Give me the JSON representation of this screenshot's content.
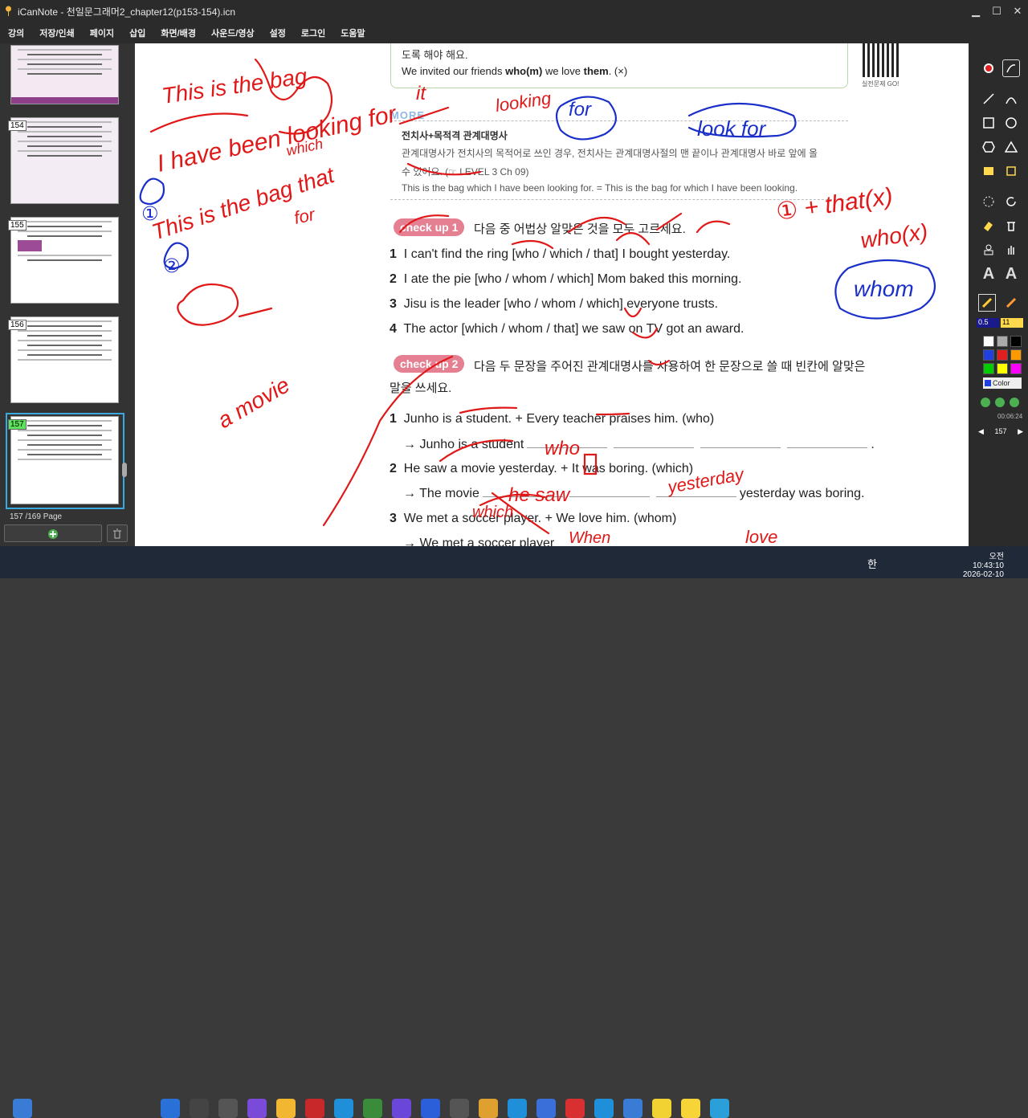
{
  "window": {
    "title": "iCanNote - 천일문그래머2_chapter12(p153-154).icn"
  },
  "menu": [
    "강의",
    "저장/인쇄",
    "페이지",
    "삽입",
    "화면/배경",
    "사운드/영상",
    "설정",
    "로그인",
    "도움말"
  ],
  "thumbnails": [
    {
      "num": "154",
      "active": false
    },
    {
      "num": "155",
      "active": false
    },
    {
      "num": "156",
      "active": false
    },
    {
      "num": "157",
      "active": true
    }
  ],
  "pageinfo": {
    "current": "157",
    "total": "/169 Page"
  },
  "doc": {
    "top_line1": "도록 해야 해요.",
    "top_line2_pre": "We invited our friends ",
    "top_line2_b1": "who(m)",
    "top_line2_mid": " we love ",
    "top_line2_b2": "them",
    "top_line2_post": ". (×)",
    "qr_label": "실전문제 GO!",
    "more_label": "MORE",
    "more_title": "전치사+목적격 관계대명사",
    "more_body1": "관계대명사가 전치사의 목적어로 쓰인 경우, 전치사는 관계대명사절의 맨 끝이나 관계대명사 바로 앞에 올",
    "more_body2": "수 있어요. (☞ LEVEL 3 Ch 09)",
    "more_ex": "This is the bag which I have been looking for. = This is the bag for which I have been looking.",
    "check1_label": "check up 1",
    "check1_instr": "다음 중 어법상 알맞은 것을 모두 고르세요.",
    "check1_items": [
      {
        "n": "1",
        "t": "I can't find the ring [who / which / that] I bought yesterday."
      },
      {
        "n": "2",
        "t": "I ate the pie [who / whom / which] Mom baked this morning."
      },
      {
        "n": "3",
        "t": "Jisu is the leader [who / whom / which] everyone trusts."
      },
      {
        "n": "4",
        "t": "The actor [which / whom / that] we saw on TV got an award."
      }
    ],
    "check2_label": "check up 2",
    "check2_instr1": "다음 두 문장을 주어진 관계대명사를 사용하여 한 문장으로 쓸 때 빈칸에 알맞은",
    "check2_instr2": "말을 쓰세요.",
    "check2_items": [
      {
        "n": "1",
        "q": "Junho is a student. + Every teacher praises him. (who)",
        "a_pre": "→ Junho is a student",
        "a_post": "."
      },
      {
        "n": "2",
        "q": "He saw a movie yesterday. + It was boring. (which)",
        "a_pre": "→ The movie",
        "a_post": "yesterday was boring."
      },
      {
        "n": "3",
        "q": "We met a soccer player. + We love him. (whom)",
        "a_pre": "→ We met a soccer player",
        "a_post": ""
      }
    ]
  },
  "ink": {
    "color": "#e01818",
    "blue": "#1a2fc9",
    "w1": "This is the bag",
    "w2": "I have been looking for",
    "w3": "it",
    "w4": "which",
    "w5": "This is the bag that",
    "w6": "for",
    "w7": "looking",
    "w8": "for",
    "w9": "look for",
    "w10": "① + that(x)",
    "w11": "who(x)",
    "w12": "whom",
    "w13": "①",
    "w14": "②",
    "w15": "a movie",
    "w16": "who",
    "w17": "he saw",
    "w18": "yesterday",
    "w19": "which",
    "w20": "When",
    "w21": "love"
  },
  "rtool": {
    "size": "0.5",
    "font": "11",
    "color_label": "Color",
    "time": "00:06:24",
    "page": "157"
  },
  "clock": {
    "time": "오전 10:43:10",
    "date": "2026-02-10",
    "ime": "한"
  },
  "colors": {
    "swatches": [
      "#ffffff",
      "#aaaaaa",
      "#555555",
      "#000000",
      "#e02020",
      "#2040e0",
      "#20a020",
      "#ff9900",
      "#00cc00",
      "#ffff00",
      "#ff00ff",
      "#00ccff"
    ]
  }
}
